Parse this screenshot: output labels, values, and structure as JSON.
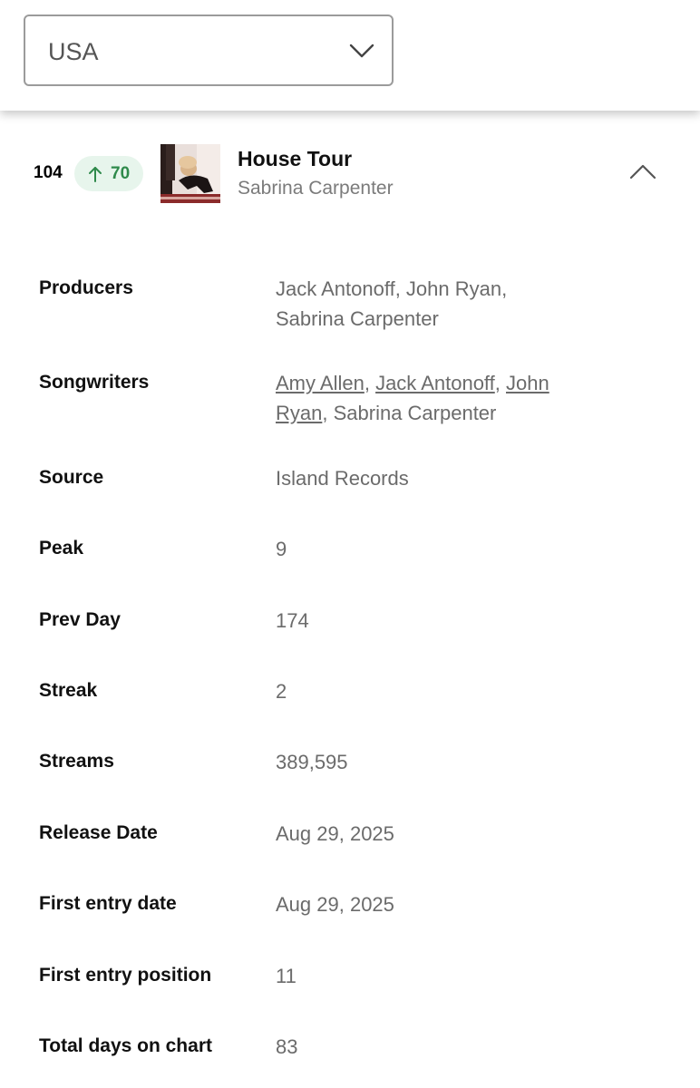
{
  "country_select": {
    "value": "USA"
  },
  "track": {
    "rank": "104",
    "change": "70",
    "change_direction": "up",
    "change_color": "#2f8a4b",
    "title": "House Tour",
    "artist": "Sabrina Carpenter"
  },
  "details": {
    "producers": {
      "label": "Producers",
      "value_line1": "Jack Antonoff, John Ryan,",
      "value_line2": "Sabrina Carpenter"
    },
    "songwriters": {
      "label": "Songwriters",
      "links": [
        "Amy Allen",
        "Jack Antonoff",
        "John",
        "Ryan"
      ],
      "plain_tail": "Sabrina Carpenter"
    },
    "source": {
      "label": "Source",
      "value": "Island Records"
    },
    "peak": {
      "label": "Peak",
      "value": "9"
    },
    "prev_day": {
      "label": "Prev Day",
      "value": "174"
    },
    "streak": {
      "label": "Streak",
      "value": "2"
    },
    "streams": {
      "label": "Streams",
      "value": "389,595"
    },
    "release_date": {
      "label": "Release Date",
      "value": "Aug 29, 2025"
    },
    "first_entry_date": {
      "label": "First entry date",
      "value": "Aug 29, 2025"
    },
    "first_entry_position": {
      "label": "First entry position",
      "value": "11"
    },
    "total_days": {
      "label": "Total days on chart",
      "value": "83"
    }
  }
}
